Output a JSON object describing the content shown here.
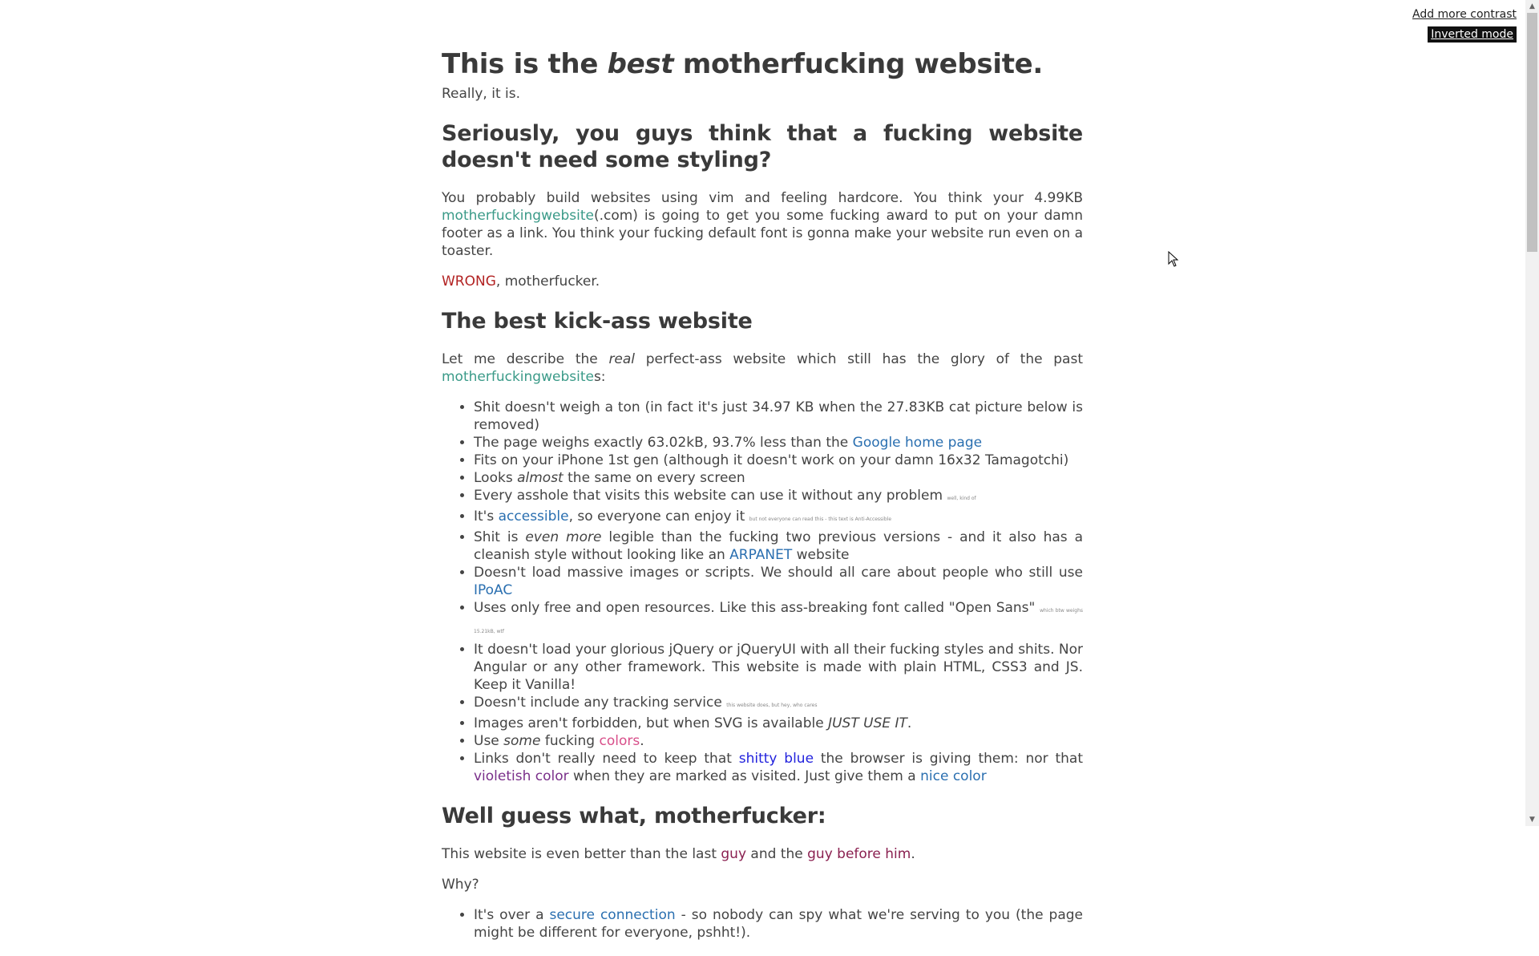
{
  "controls": {
    "contrast": "Add more contrast",
    "inverted": "Inverted mode"
  },
  "h1": {
    "pre": "This is the ",
    "em": "best",
    "post": " motherfucking website."
  },
  "subtitle": "Really, it is.",
  "h2_1": "Seriously, you guys think that a fucking website doesn't need some styling?",
  "intro": {
    "part1": "You probably build websites using vim and feeling hardcore. You think your 4.99KB ",
    "link": "motherfuckingwebsite",
    "part2": "(.com) is going to get you some fucking award to put on your damn footer as a link. You think your fucking default font is gonna make your website run even on a toaster."
  },
  "wrong": {
    "link": "WRONG",
    "rest": ", motherfucker."
  },
  "h2_2": "The best kick-ass website",
  "describe": {
    "pre": "Let me describe the ",
    "em": "real",
    "mid": " perfect-ass website which still has the glory of the past ",
    "link": "motherfuckingwebsite",
    "post": "s:"
  },
  "list": {
    "i1": "Shit doesn't weigh a ton (in fact it's just 34.97 KB when the 27.83KB cat picture below is removed)",
    "i2_pre": "The page weighs exactly 63.02kB, 93.7% less than the ",
    "i2_link": "Google home page",
    "i3": "Fits on your iPhone 1st gen (although it doesn't work on your damn 16x32 Tamagotchi)",
    "i4_pre": "Looks ",
    "i4_em": "almost",
    "i4_post": " the same on every screen",
    "i5": "Every asshole that visits this website can use it without any problem",
    "i5_small": "well, kind of",
    "i6_pre": "It's ",
    "i6_link": "accessible",
    "i6_post": ", so everyone can enjoy it",
    "i6_small": "but not everyone can read this - this text is Anti-Accessible",
    "i7_pre": "Shit is ",
    "i7_em": "even more",
    "i7_mid": " legible than the fucking two previous versions - and it also has a cleanish style without looking like an ",
    "i7_link": "ARPANET",
    "i7_post": " website",
    "i8_pre": "Doesn't load massive images or scripts. We should all care about people who still use ",
    "i8_link": "IPoAC",
    "i9": "Uses only free and open resources. Like this ass-breaking font called \"Open Sans\"",
    "i9_small": "which btw weighs 15.21kB, wtf",
    "i10": "It doesn't load your glorious jQuery or jQueryUI with all their fucking styles and shits. Nor Angular or any other framework. This website is made with plain HTML, CSS3 and JS. Keep it Vanilla!",
    "i11": "Doesn't include any tracking service",
    "i11_small": "this website does, but hey, who cares",
    "i12_pre": "Images aren't forbidden, but when SVG is available ",
    "i12_em": "JUST USE IT",
    "i12_post": ".",
    "i13_pre": "Use ",
    "i13_em": "some",
    "i13_mid": " fucking ",
    "i13_colors": "colors",
    "i13_post": ".",
    "i14_pre": "Links don't really need to keep that ",
    "i14_blue": "shitty blue",
    "i14_mid": " the browser is giving them: nor that ",
    "i14_violet": "violetish color",
    "i14_mid2": " when they are marked as visited. Just give them a ",
    "i14_link": "nice color"
  },
  "h2_3": "Well guess what, motherfucker:",
  "better": {
    "pre": "This website is even better than the last ",
    "link1": "guy",
    "mid": " and the ",
    "link2": "guy before him",
    "post": "."
  },
  "why": "Why?",
  "why_list": {
    "i1_pre": "It's over a ",
    "i1_link": "secure connection",
    "i1_post": " - so nobody can spy what we're serving to you (the page might be different for everyone, pshht!)."
  },
  "colors": {
    "accent": "#3a9a88",
    "link": "#2a6fb0",
    "wrong": "#b22222"
  }
}
